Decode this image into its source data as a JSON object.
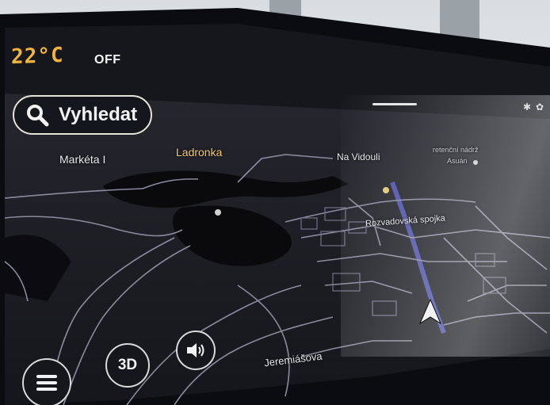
{
  "climate": {
    "temperature": "22°C",
    "ac_state": "OFF"
  },
  "search": {
    "label": "Vyhledat",
    "icon": "search-icon"
  },
  "map": {
    "labels": {
      "marketa": "Markéta I",
      "ladronka": "Ladronka",
      "na_vidouli": "Na Vidouli",
      "retencni": "retenční nádrž",
      "asuan": "Asuán",
      "rozvadovska": "Rozvadovská spojka",
      "jeremiasova": "Jeremiášova"
    },
    "mode_3d_label": "3D",
    "colors": {
      "map_background": "#1a1b23",
      "roads": "#7d7d92",
      "highlight_road": "#3b3f8f",
      "accent": "#f2b43a"
    }
  },
  "controls": {
    "menu_icon": "hamburger-menu-icon",
    "sound_icon": "speaker-icon",
    "position_icon": "navigation-arrow-icon",
    "status_icons": [
      "bluetooth-icon",
      "settings-icon"
    ]
  }
}
